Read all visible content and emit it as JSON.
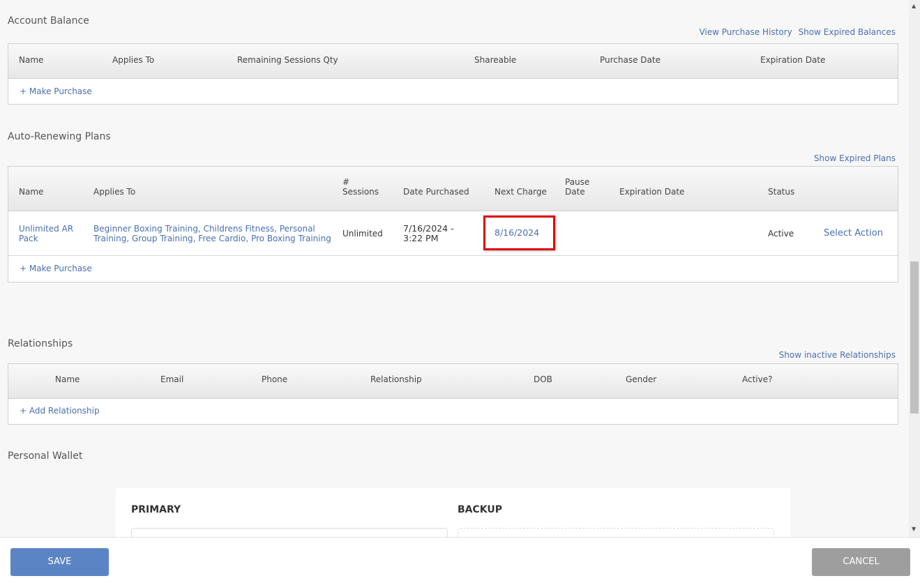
{
  "account_balance": {
    "title": "Account Balance",
    "links": {
      "view_history": "View Purchase History",
      "show_expired": "Show Expired Balances"
    },
    "columns": [
      "Name",
      "Applies To",
      "Remaining Sessions Qty",
      "Shareable",
      "Purchase Date",
      "Expiration Date"
    ],
    "make_purchase": "+ Make Purchase"
  },
  "auto_renewing": {
    "title": "Auto-Renewing Plans",
    "show_expired": "Show Expired Plans",
    "columns": {
      "name": "Name",
      "applies_to": "Applies To",
      "sessions_line1": "#",
      "sessions_line2": "Sessions",
      "date_purchased": "Date Purchased",
      "next_charge": "Next Charge",
      "pause_line1": "Pause",
      "pause_line2": "Date",
      "expiration": "Expiration Date",
      "status": "Status"
    },
    "row": {
      "name_line1": "Unlimited AR",
      "name_line2": "Pack",
      "applies_line1": "Beginner Boxing Training, Childrens Fitness, Personal",
      "applies_line2": "Training, Group Training, Free Cardio, Pro Boxing Training",
      "sessions": "Unlimited",
      "date_line1": "7/16/2024 -",
      "date_line2": "3:22 PM",
      "next_charge": "8/16/2024",
      "status": "Active",
      "action": "Select Action"
    },
    "make_purchase": "+ Make Purchase",
    "highlight_color": "#e0000f"
  },
  "relationships": {
    "title": "Relationships",
    "show_inactive": "Show inactive Relationships",
    "columns": [
      "Name",
      "Email",
      "Phone",
      "Relationship",
      "DOB",
      "Gender",
      "Active?"
    ],
    "add": "+ Add Relationship"
  },
  "wallet": {
    "title": "Personal Wallet",
    "primary": "PRIMARY",
    "backup": "BACKUP"
  },
  "buttons": {
    "save": "SAVE",
    "cancel": "CANCEL"
  },
  "colors": {
    "link": "#4a6fb0",
    "save": "#5b84c4",
    "cancel": "#9e9e9e"
  }
}
